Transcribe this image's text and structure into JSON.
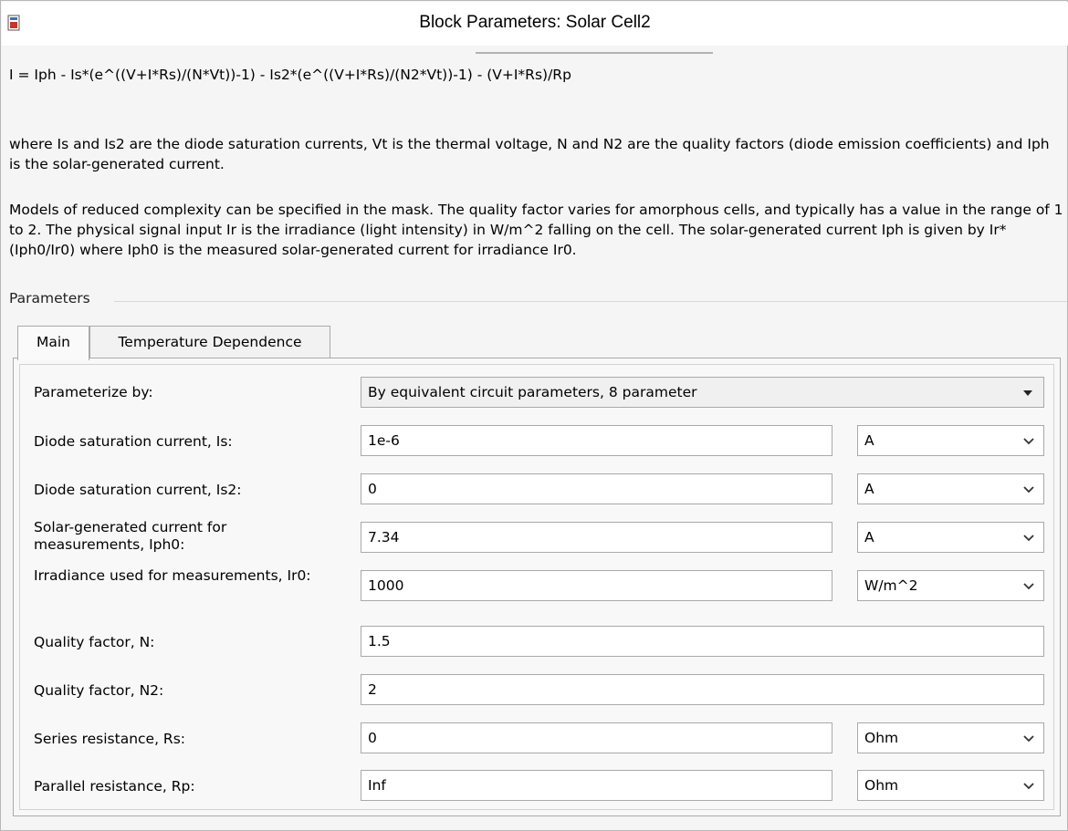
{
  "window": {
    "title": "Block Parameters: Solar Cell2",
    "icon": "block-icon"
  },
  "description": {
    "equation": "I = Iph - Is*(e^((V+I*Rs)/(N*Vt))-1) - Is2*(e^((V+I*Rs)/(N2*Vt))-1) - (V+I*Rs)/Rp",
    "paragraph1": "where Is and Is2 are the diode saturation currents, Vt is the thermal voltage, N and N2 are the quality factors (diode emission coefficients) and Iph is the solar-generated current.",
    "paragraph2": "Models of reduced complexity can be specified in the mask. The quality factor varies for amorphous cells, and typically has a value in the range of 1 to 2. The physical signal input Ir is the irradiance (light intensity) in W/m^2 falling on the cell. The solar-generated current Iph is given by Ir*(Iph0/Ir0) where Iph0 is the measured solar-generated current for irradiance Ir0."
  },
  "parameters": {
    "legend": "Parameters",
    "tabs": [
      {
        "label": "Main"
      },
      {
        "label": "Temperature Dependence"
      }
    ],
    "parameterize": {
      "label": "Parameterize by:",
      "value": "By equivalent circuit parameters, 8 parameter"
    },
    "rows": [
      {
        "label": "Diode saturation current, Is:",
        "value": "1e-6",
        "unit": "A"
      },
      {
        "label": "Diode saturation current, Is2:",
        "value": "0",
        "unit": "A"
      },
      {
        "label": "Solar-generated current for measurements, Iph0:",
        "value": "7.34",
        "unit": "A"
      },
      {
        "label": "Irradiance used for measurements, Ir0:",
        "value": "1000",
        "unit": "W/m^2"
      },
      {
        "label": "Quality factor, N:",
        "value": "1.5"
      },
      {
        "label": "Quality factor, N2:",
        "value": "2"
      },
      {
        "label": "Series resistance, Rs:",
        "value": "0",
        "unit": "Ohm"
      },
      {
        "label": "Parallel resistance, Rp:",
        "value": "Inf",
        "unit": "Ohm"
      }
    ]
  },
  "colors": {
    "frame": "#b8b8b8",
    "panel": "#f8f8f8",
    "field_border": "#a9a9a9"
  },
  "icons": [
    "block-icon",
    "chevron-down-icon",
    "dropdown-arrow-icon"
  ]
}
